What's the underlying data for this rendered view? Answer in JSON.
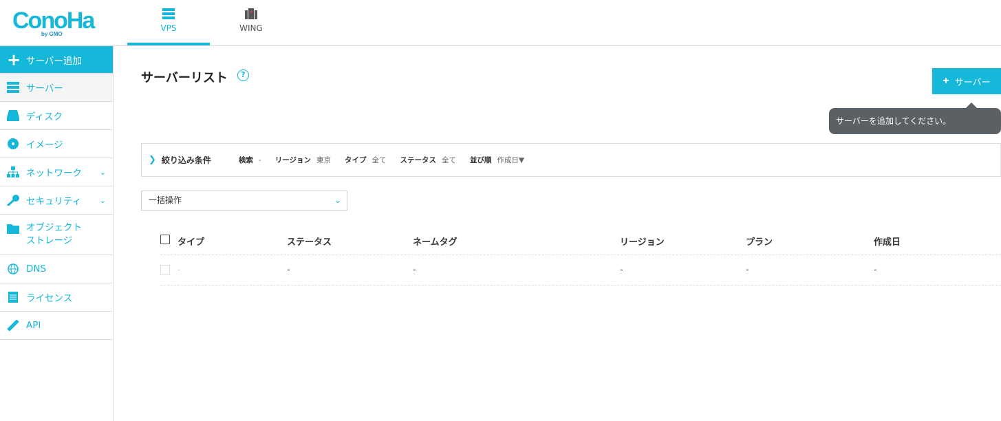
{
  "header": {
    "logo": "ConoHa",
    "logo_sub": "by GMO",
    "tabs": [
      {
        "label": "VPS",
        "icon": "server-stack-icon",
        "active": true
      },
      {
        "label": "WING",
        "icon": "wing-server-icon",
        "active": false
      }
    ]
  },
  "sidebar": {
    "items": [
      {
        "label": "サーバー追加",
        "icon": "plus-icon"
      },
      {
        "label": "サーバー",
        "icon": "server-icon"
      },
      {
        "label": "ディスク",
        "icon": "disk-icon"
      },
      {
        "label": "イメージ",
        "icon": "image-disc-icon"
      },
      {
        "label": "ネットワーク",
        "icon": "network-icon"
      },
      {
        "label": "セキュリティ",
        "icon": "key-icon"
      },
      {
        "label": "オブジェクト",
        "label2": "ストレージ",
        "icon": "folder-icon"
      },
      {
        "label": "DNS",
        "icon": "globe-icon"
      },
      {
        "label": "ライセンス",
        "icon": "document-icon"
      },
      {
        "label": "API",
        "icon": "plug-icon"
      }
    ]
  },
  "main": {
    "title": "サーバーリスト",
    "help": "?",
    "add_button": "サーバー",
    "tooltip": "サーバーを追加してください。",
    "filter": {
      "title": "絞り込み条件",
      "fields": [
        {
          "label": "検索",
          "value": "-"
        },
        {
          "label": "リージョン",
          "value": "東京"
        },
        {
          "label": "タイプ",
          "value": "全て"
        },
        {
          "label": "ステータス",
          "value": "全て"
        },
        {
          "label": "並び順",
          "value": "作成日▼"
        }
      ]
    },
    "bulk_select": "一括操作",
    "table": {
      "columns": [
        "タイプ",
        "ステータス",
        "ネームタグ",
        "リージョン",
        "プラン",
        "作成日"
      ],
      "rows": [
        [
          "-",
          "-",
          "-",
          "-",
          "-",
          "-"
        ]
      ]
    }
  },
  "colors": {
    "accent": "#15b8d9",
    "tooltip": "#5b6064"
  }
}
